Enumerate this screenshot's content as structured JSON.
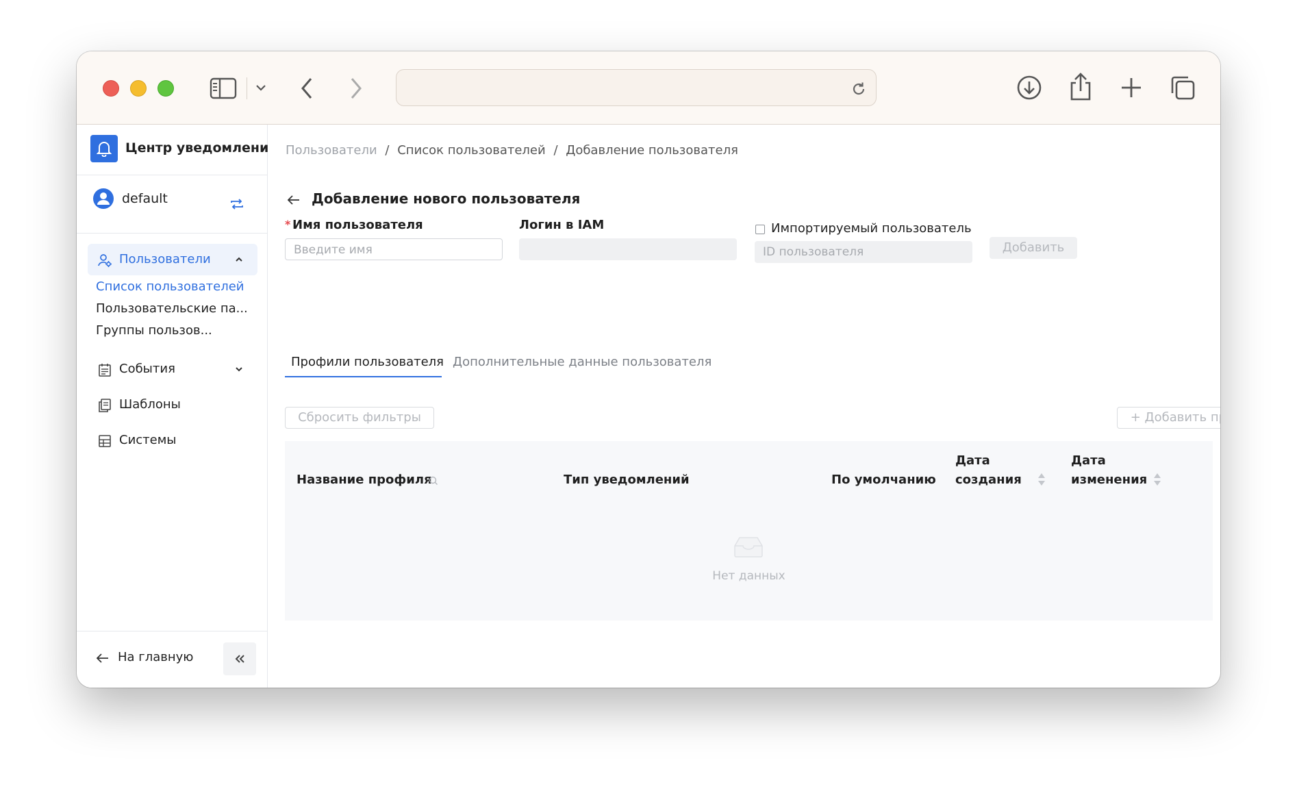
{
  "browser": {
    "url": ""
  },
  "app": {
    "title": "Центр уведомлений",
    "tenant": "default"
  },
  "sidebar": {
    "users_label": "Пользователи",
    "sub_items": [
      {
        "label": "Список пользователей",
        "active": true
      },
      {
        "label": "Пользовательские па..."
      },
      {
        "label": "Группы пользов..."
      }
    ],
    "items": [
      {
        "label": "События"
      },
      {
        "label": "Шаблоны"
      },
      {
        "label": "Системы"
      }
    ],
    "home_label": "На главную"
  },
  "breadcrumb": [
    "Пользователи",
    "Список пользователей",
    "Добавление пользователя"
  ],
  "breadcrumb_separator": "/",
  "page_title": "Добавление нового пользователя",
  "form": {
    "required_mark": "*",
    "username_label": "Имя пользователя",
    "username_placeholder": "Введите имя",
    "iam_label": "Логин в IAM",
    "iam_value": "",
    "imported_label": "Импортируемый пользователь",
    "imported_checked": false,
    "user_id_placeholder": "ID пользователя",
    "add_button": "Добавить"
  },
  "tabs": [
    {
      "label": "Профили пользователя",
      "active": true
    },
    {
      "label": "Дополнительные данные пользователя",
      "active": false
    }
  ],
  "toolbar": {
    "reset_filters": "Сбросить фильтры",
    "add_profile": "+ Добавить профиль"
  },
  "table": {
    "columns": [
      {
        "line1": "Название профиля",
        "line2": ""
      },
      {
        "line1": "Тип уведомлений",
        "line2": ""
      },
      {
        "line1": "По умолчанию",
        "line2": ""
      },
      {
        "line1": "Дата",
        "line2": "создания"
      },
      {
        "line1": "Дата",
        "line2": "изменения"
      }
    ],
    "rows": [],
    "empty_text": "Нет данных"
  },
  "colors": {
    "accent": "#2f6fdf",
    "brand_tile": "#2f6fdf",
    "required": "#e5484d",
    "disabled_text": "#b5b8bd",
    "table_header_bg": "#f7f8fa"
  }
}
